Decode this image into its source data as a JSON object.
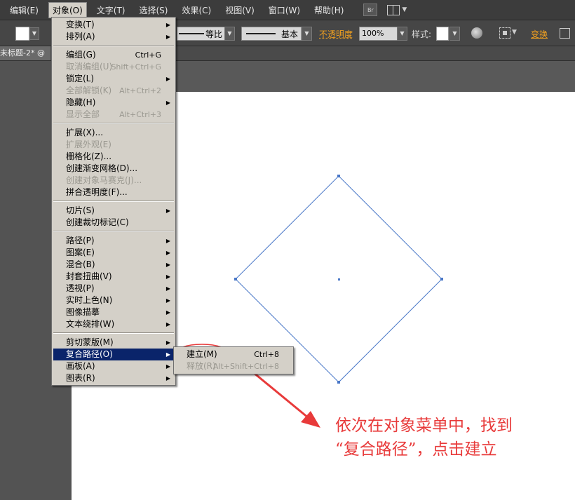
{
  "menubar": {
    "items": [
      "编辑(E)",
      "对象(O)",
      "文字(T)",
      "选择(S)",
      "效果(C)",
      "视图(V)",
      "窗口(W)",
      "帮助(H)"
    ],
    "bridge_label": "Br"
  },
  "controlbar": {
    "stroke_profile_label": "等比",
    "brush_label": "基本",
    "opacity_label": "不透明度",
    "opacity_value": "100%",
    "style_label": "样式:",
    "transform_label": "变换"
  },
  "document_tab": "未标题-2* @",
  "object_menu": {
    "groups": [
      [
        {
          "label": "变换(T)",
          "submenu": true
        },
        {
          "label": "排列(A)",
          "submenu": true
        }
      ],
      [
        {
          "label": "编组(G)",
          "shortcut": "Ctrl+G"
        },
        {
          "label": "取消编组(U)",
          "shortcut": "Shift+Ctrl+G",
          "disabled": true
        },
        {
          "label": "锁定(L)",
          "submenu": true
        },
        {
          "label": "全部解锁(K)",
          "shortcut": "Alt+Ctrl+2",
          "disabled": true
        },
        {
          "label": "隐藏(H)",
          "submenu": true
        },
        {
          "label": "显示全部",
          "shortcut": "Alt+Ctrl+3",
          "disabled": true
        }
      ],
      [
        {
          "label": "扩展(X)..."
        },
        {
          "label": "扩展外观(E)",
          "disabled": true
        },
        {
          "label": "栅格化(Z)..."
        },
        {
          "label": "创建渐变网格(D)..."
        },
        {
          "label": "创建对象马赛克(J)...",
          "disabled": true
        },
        {
          "label": "拼合透明度(F)..."
        }
      ],
      [
        {
          "label": "切片(S)",
          "submenu": true
        },
        {
          "label": "创建裁切标记(C)"
        }
      ],
      [
        {
          "label": "路径(P)",
          "submenu": true
        },
        {
          "label": "图案(E)",
          "submenu": true
        },
        {
          "label": "混合(B)",
          "submenu": true
        },
        {
          "label": "封套扭曲(V)",
          "submenu": true
        },
        {
          "label": "透视(P)",
          "submenu": true
        },
        {
          "label": "实时上色(N)",
          "submenu": true
        },
        {
          "label": "图像描摹",
          "submenu": true
        },
        {
          "label": "文本绕排(W)",
          "submenu": true
        }
      ],
      [
        {
          "label": "剪切蒙版(M)",
          "submenu": true
        },
        {
          "label": "复合路径(O)",
          "submenu": true,
          "highlighted": true
        },
        {
          "label": "画板(A)",
          "submenu": true
        },
        {
          "label": "图表(R)",
          "submenu": true
        }
      ]
    ]
  },
  "compound_path_submenu": [
    {
      "label": "建立(M)",
      "shortcut": "Ctrl+8"
    },
    {
      "label": "释放(R)",
      "shortcut": "Alt+Shift+Ctrl+8",
      "disabled": true
    }
  ],
  "annotation": {
    "line1": "依次在对象菜单中，找到",
    "line2": "“复合路径”，点击建立",
    "color": "#e83a3a"
  },
  "colors": {
    "selection_blue": "#4a78c8",
    "menu_highlight": "#0a246a",
    "menu_bg": "#d4d0c8",
    "accent_orange": "#f0a020"
  }
}
